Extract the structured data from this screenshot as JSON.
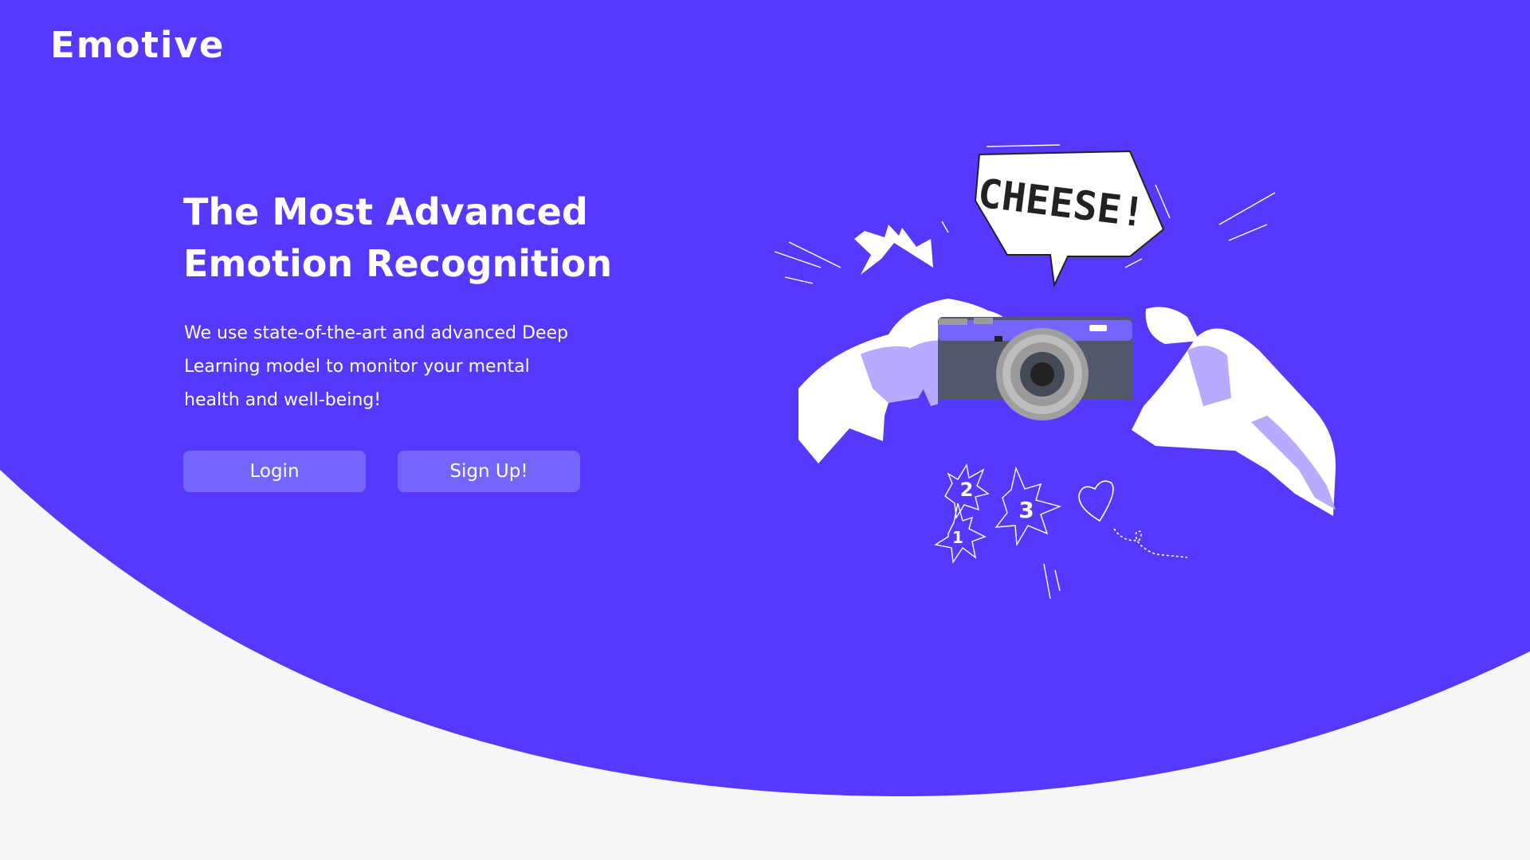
{
  "brand": {
    "name": "Emotive"
  },
  "colors": {
    "hero_bg": "#5539ff",
    "page_bg": "#f6f7f9",
    "button_bg": "#7466fc",
    "text": "#ffffff"
  },
  "hero": {
    "headline_line1": "The Most Advanced",
    "headline_line2": "Emotion Recognition",
    "description_line1": "We use state-of-the-art and advanced Deep",
    "description_line2": "Learning model to monitor your mental",
    "description_line3": "health and well-being!"
  },
  "actions": {
    "login_label": "Login",
    "signup_label": "Sign Up!"
  },
  "illustration": {
    "speech_bubble_text": "CHEESE!",
    "burst_numbers": [
      "1",
      "2",
      "3"
    ]
  }
}
